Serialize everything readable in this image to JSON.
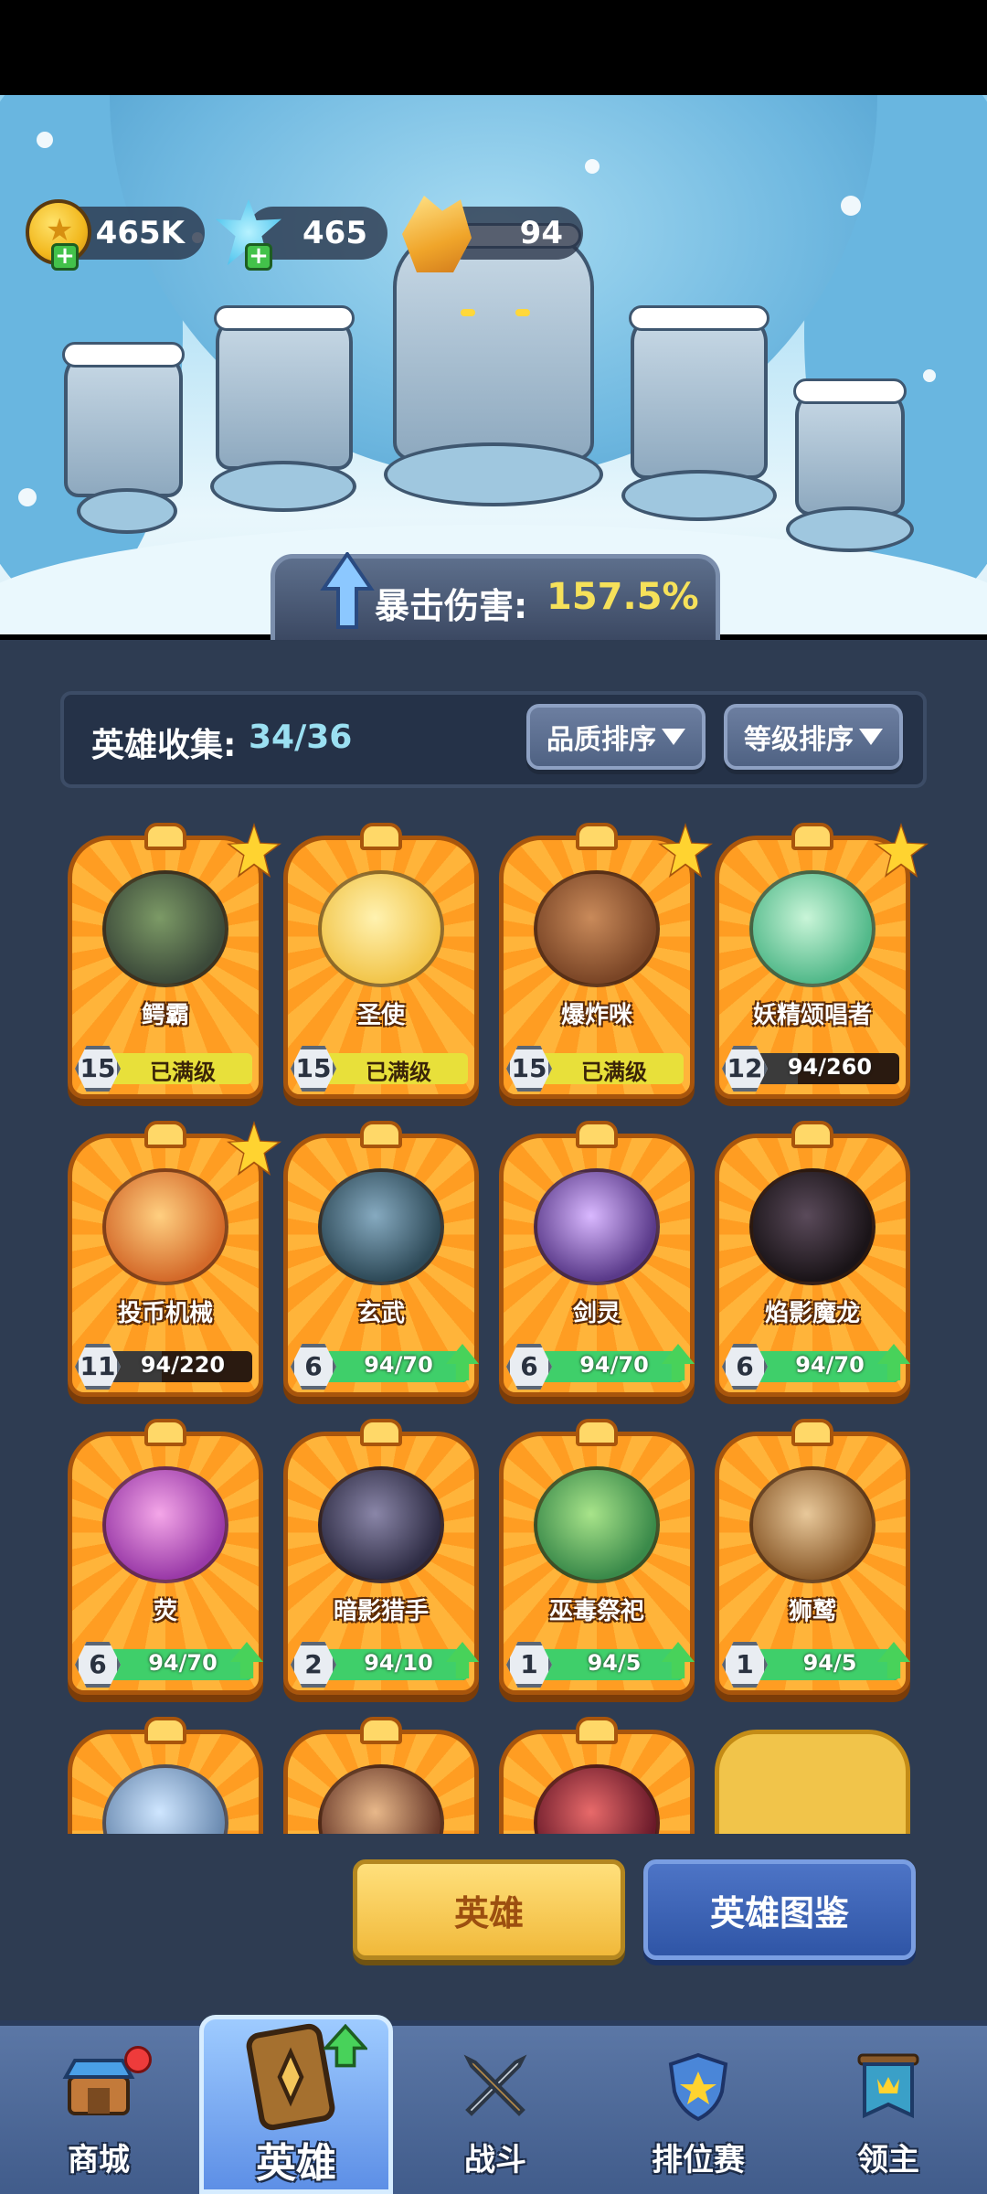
{
  "currencies": [
    {
      "name": "gold",
      "value": "465K"
    },
    {
      "name": "diamond",
      "value": "465"
    },
    {
      "name": "crystal",
      "value": "94"
    }
  ],
  "crit": {
    "label": "暴击伤害:",
    "value": "157.5%"
  },
  "collection": {
    "label": "英雄收集:",
    "value": "34/36"
  },
  "sort": {
    "quality": "品质排序",
    "level": "等级排序"
  },
  "heroes": [
    {
      "name": "鳄霸",
      "level": "15",
      "progress": "已满级",
      "maxed": true,
      "star": true,
      "fill": 1.0,
      "c1": "#7c9a66",
      "c2": "#3c4a3a"
    },
    {
      "name": "圣使",
      "level": "15",
      "progress": "已满级",
      "maxed": true,
      "star": false,
      "fill": 1.0,
      "c1": "#fff2b0",
      "c2": "#f2c54a"
    },
    {
      "name": "爆炸咪",
      "level": "15",
      "progress": "已满级",
      "maxed": true,
      "star": true,
      "fill": 1.0,
      "c1": "#c98a5a",
      "c2": "#7a4526"
    },
    {
      "name": "妖精颂唱者",
      "level": "12",
      "progress": "94/260",
      "maxed": false,
      "star": true,
      "fill": 0.36,
      "c1": "#c9f5d8",
      "c2": "#52b98a"
    },
    {
      "name": "投币机械",
      "level": "11",
      "progress": "94/220",
      "maxed": false,
      "star": true,
      "fill": 0.43,
      "c1": "#ffcf80",
      "c2": "#d46a2a"
    },
    {
      "name": "玄武",
      "level": "6",
      "progress": "94/70",
      "maxed": false,
      "star": false,
      "fill": 1.0,
      "up": true,
      "c1": "#86aac0",
      "c2": "#2e4a58"
    },
    {
      "name": "剑灵",
      "level": "6",
      "progress": "94/70",
      "maxed": false,
      "star": false,
      "fill": 1.0,
      "up": true,
      "c1": "#d9b8ff",
      "c2": "#5a3a8a"
    },
    {
      "name": "焰影魔龙",
      "level": "6",
      "progress": "94/70",
      "maxed": false,
      "star": false,
      "fill": 1.0,
      "up": true,
      "c1": "#5a4a5a",
      "c2": "#1a1418"
    },
    {
      "name": "荧",
      "level": "6",
      "progress": "94/70",
      "maxed": false,
      "star": false,
      "fill": 1.0,
      "up": true,
      "c1": "#f4a6e8",
      "c2": "#9a3aa8"
    },
    {
      "name": "暗影猎手",
      "level": "2",
      "progress": "94/10",
      "maxed": false,
      "star": false,
      "fill": 1.0,
      "up": true,
      "c1": "#8a86a8",
      "c2": "#2e2c44"
    },
    {
      "name": "巫毒祭祀",
      "level": "1",
      "progress": "94/5",
      "maxed": false,
      "star": false,
      "fill": 1.0,
      "up": true,
      "c1": "#a8e48a",
      "c2": "#3a8a4a"
    },
    {
      "name": "狮鹫",
      "level": "1",
      "progress": "94/5",
      "maxed": false,
      "star": false,
      "fill": 1.0,
      "up": true,
      "c1": "#e8c89a",
      "c2": "#8a5a2a"
    }
  ],
  "tabs": {
    "heroes": "英雄",
    "codex": "英雄图鉴"
  },
  "nav": [
    {
      "label": "商城",
      "icon": "shop-icon"
    },
    {
      "label": "英雄",
      "icon": "hero-card-icon"
    },
    {
      "label": "战斗",
      "icon": "crossed-swords-icon"
    },
    {
      "label": "排位赛",
      "icon": "ranking-shield-icon"
    },
    {
      "label": "领主",
      "icon": "lord-banner-icon"
    }
  ],
  "colors": {
    "gold_text": "#f6e15a",
    "accent_blue": "#9be0f2",
    "panel": "#2e3c52",
    "card_orange": "#ff9d22"
  }
}
